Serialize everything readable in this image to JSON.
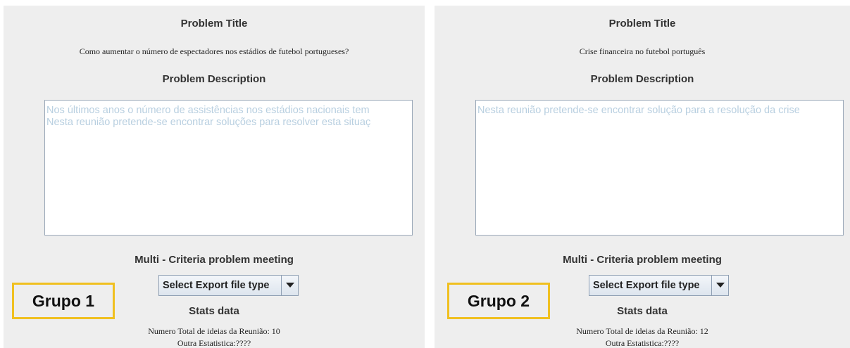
{
  "panels": [
    {
      "title_label": "Problem Title",
      "title_value": "Como aumentar o número de espectadores nos estádios de futebol portugueses?",
      "description_label": "Problem Description",
      "description_lines": [
        "Nos últimos anos o número de assistências nos estádios nacionais tem",
        "Nesta reunião pretende-se encontrar soluções para resolver esta situaç"
      ],
      "meeting_type": "Multi - Criteria problem meeting",
      "export_select_label": "Select Export file type",
      "stats_label": "Stats data",
      "stats_total": "Numero Total de ideias da Reunião: 10",
      "stats_other": "Outra Estatistica:????",
      "group_label": "Grupo 1"
    },
    {
      "title_label": "Problem Title",
      "title_value": "Crise financeira no futebol português",
      "description_label": "Problem Description",
      "description_lines": [
        "Nesta reunião pretende-se encontrar solução para a resolução da crise"
      ],
      "meeting_type": "Multi - Criteria problem meeting",
      "export_select_label": "Select Export file type",
      "stats_label": "Stats data",
      "stats_total": "Numero Total de ideias da Reunião: 12",
      "stats_other": "Outra Estatistica:????",
      "group_label": "Grupo 2"
    }
  ],
  "colors": {
    "panel_background": "#eeeeee",
    "description_text": "#b8cfe0",
    "group_border": "#f0c020"
  },
  "icons": {
    "dropdown": "chevron-down-icon"
  }
}
